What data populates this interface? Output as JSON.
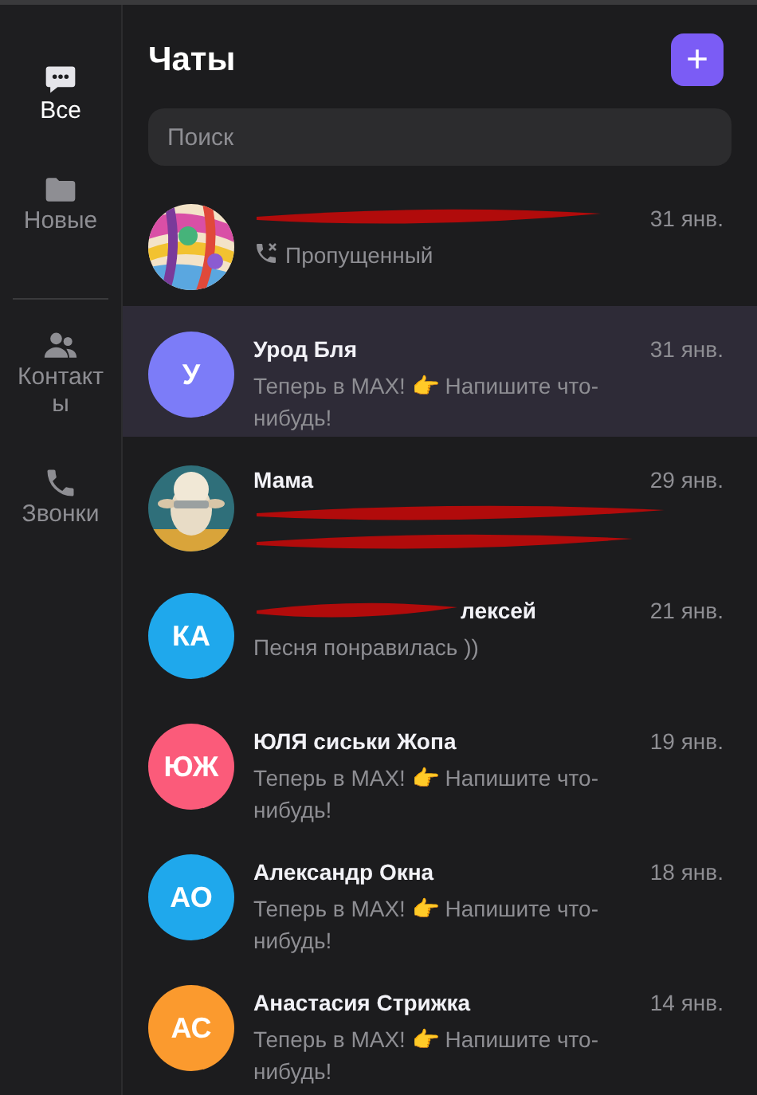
{
  "sidebar": {
    "items": [
      {
        "kind": "chats",
        "label": "Все",
        "selected": true
      },
      {
        "kind": "folder",
        "label": "Новые",
        "selected": false
      },
      {
        "kind": "divider"
      },
      {
        "kind": "contacts",
        "label": "Контакты",
        "selected": false
      },
      {
        "kind": "calls",
        "label": "Звонки",
        "selected": false
      }
    ]
  },
  "header": {
    "title": "Чаты",
    "new_button": "+"
  },
  "search": {
    "placeholder": "Поиск"
  },
  "chats": [
    {
      "name_redacted": true,
      "time": "31 янв.",
      "preview": "Пропущенный",
      "missed_call": true,
      "selected": false
    },
    {
      "avatar": {
        "kind": "initials",
        "initials": "У",
        "color": "#7c7cf8"
      },
      "name": "Урод Бля",
      "time": "31 янв.",
      "preview": "Теперь в MAX! 👉 Напишите что-нибудь!",
      "selected": true
    },
    {
      "name": "Мама",
      "time": "29 янв.",
      "preview_redacted": true,
      "selected": false
    },
    {
      "avatar": {
        "kind": "initials",
        "initials": "КА",
        "color": "#1fa8ec"
      },
      "name_redacted": true,
      "name_tail": "лексей",
      "time": "21 янв.",
      "preview": "Песня понравилась ))",
      "selected": false
    },
    {
      "avatar": {
        "kind": "initials",
        "initials": "ЮЖ",
        "color": "#fb5b7a"
      },
      "name": "ЮЛЯ сиськи Жопа",
      "time": "19 янв.",
      "preview": "Теперь в MAX! 👉 Напишите что-нибудь!",
      "selected": false
    },
    {
      "avatar": {
        "kind": "initials",
        "initials": "АО",
        "color": "#1fa8ec"
      },
      "name": "Александр Окна",
      "time": "18 янв.",
      "preview": "Теперь в MAX! 👉 Напишите что-нибудь!",
      "selected": false
    },
    {
      "avatar": {
        "kind": "initials",
        "initials": "АС",
        "color": "#fb9a2e"
      },
      "name": "Анастасия Стрижка",
      "time": "14 янв.",
      "preview": "Теперь в MAX! 👉 Напишите что-нибудь!",
      "selected": false
    }
  ]
}
